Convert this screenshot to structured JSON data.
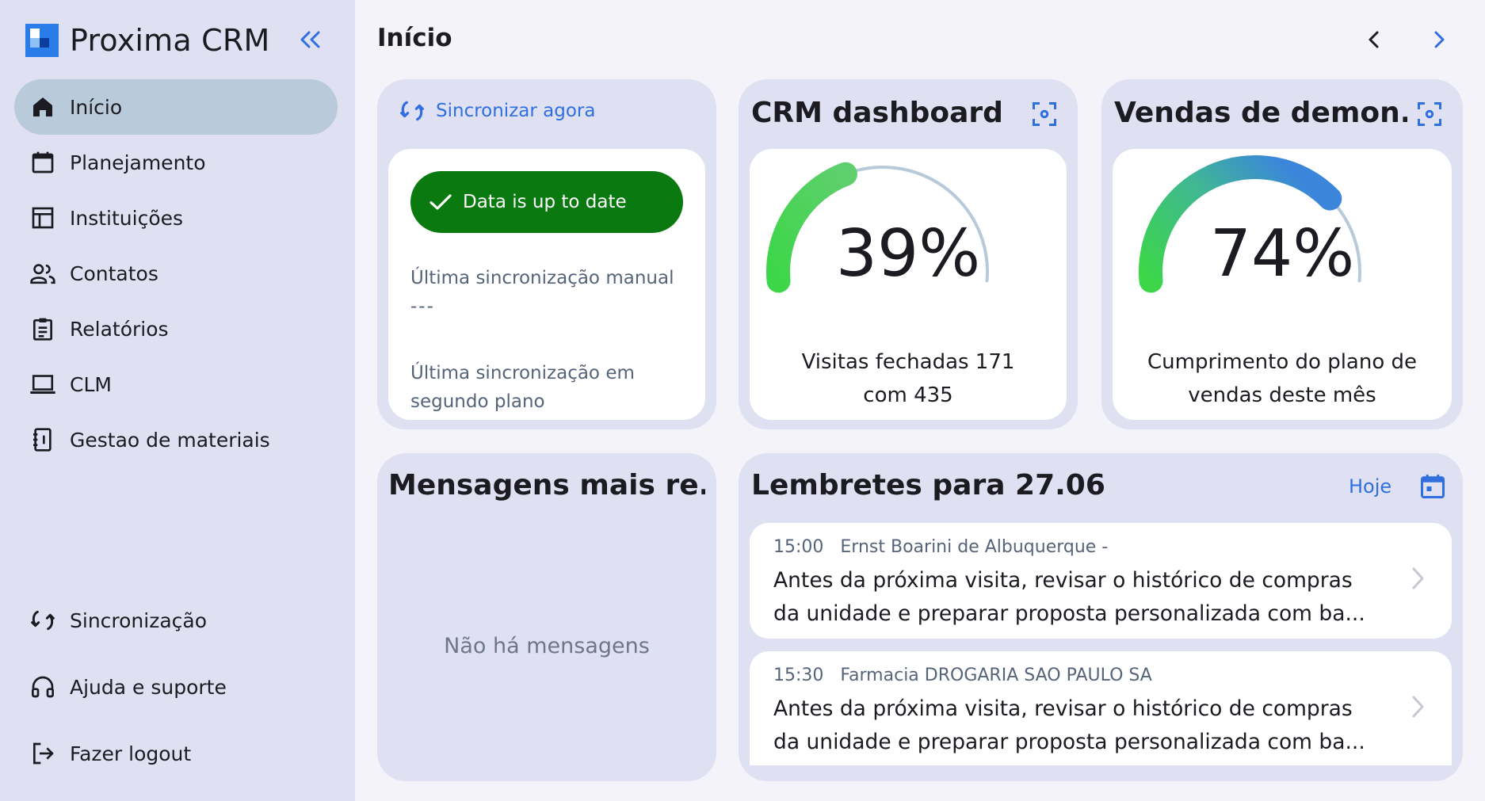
{
  "app": {
    "title": "Proxima CRM"
  },
  "sidebar": {
    "items": [
      {
        "label": "Início",
        "icon": "home-icon",
        "active": true
      },
      {
        "label": "Planejamento",
        "icon": "calendar-icon"
      },
      {
        "label": "Instituições",
        "icon": "institution-icon"
      },
      {
        "label": "Contatos",
        "icon": "contacts-icon"
      },
      {
        "label": "Relatórios",
        "icon": "clipboard-icon"
      },
      {
        "label": "CLM",
        "icon": "laptop-icon"
      },
      {
        "label": "Gestao de materiais",
        "icon": "notebook-icon"
      }
    ],
    "footer": [
      {
        "label": "Sincronização",
        "icon": "sync-icon"
      },
      {
        "label": "Ajuda e suporte",
        "icon": "headset-icon"
      },
      {
        "label": "Fazer logout",
        "icon": "logout-icon"
      }
    ]
  },
  "header": {
    "title": "Início"
  },
  "sync_card": {
    "link_label": "Sincronizar agora",
    "status": "Data is up to date",
    "manual_label": "Última sincronização manual",
    "manual_value": "---",
    "background_label_1": "Última sincronização em",
    "background_label_2": "segundo plano"
  },
  "crm_card": {
    "title": "CRM dashboard",
    "percent": 39,
    "percent_text": "39%",
    "caption_1": "Visitas fechadas 171",
    "caption_2": "com 435"
  },
  "sales_card": {
    "title": "Vendas de demon...",
    "percent": 74,
    "percent_text": "74%",
    "caption_1": "Cumprimento do plano de",
    "caption_2": "vendas deste mês"
  },
  "messages_card": {
    "title": "Mensagens mais re...",
    "empty": "Não há mensagens"
  },
  "reminders_card": {
    "title": "Lembretes para 27.06",
    "today_label": "Hoje",
    "items": [
      {
        "time": "15:00",
        "who": "Ernst Boarini de Albuquerque -",
        "line1": "Antes da próxima visita, revisar o histórico de compras",
        "line2": "da unidade e preparar proposta personalizada com ba..."
      },
      {
        "time": "15:30",
        "who": "Farmacia DROGARIA SAO PAULO SA",
        "line1": "Antes da próxima visita, revisar o histórico de compras",
        "line2": "da unidade e preparar proposta personalizada com ba..."
      }
    ]
  },
  "colors": {
    "accent": "#2f6fe0",
    "success": "#0a7a10",
    "sidebar_bg": "#dfe1f2",
    "active_nav": "#b9cbdb"
  }
}
